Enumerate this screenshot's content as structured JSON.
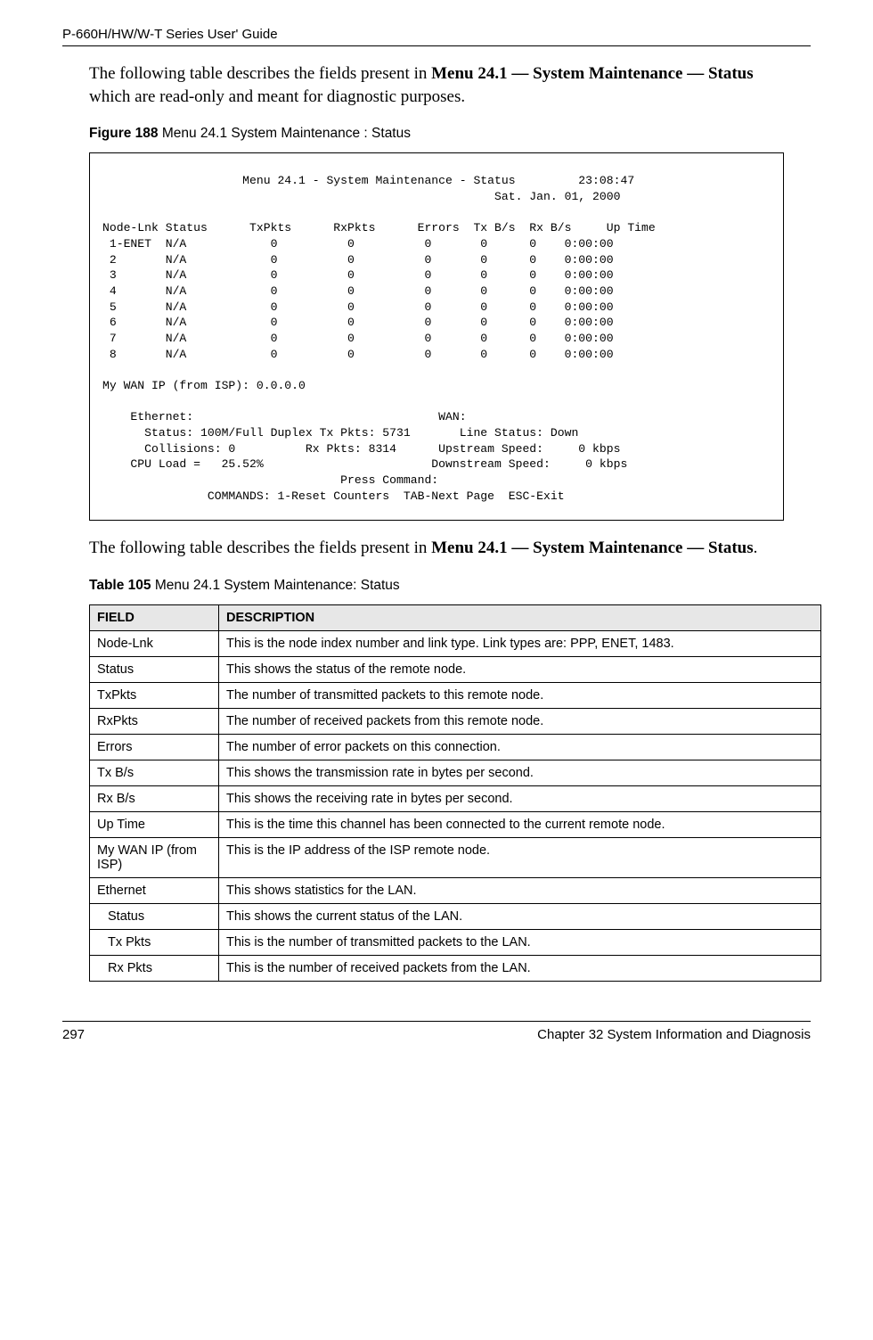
{
  "running_head": "P-660H/HW/W-T Series User' Guide",
  "para1_before": "The following table describes the fields present in ",
  "para1_bold": "Menu 24.1 — System Maintenance — Status",
  "para1_after": " which are read-only and meant for diagnostic purposes.",
  "figure_lead": "Figure 188",
  "figure_title": "   Menu 24.1 System Maintenance : Status",
  "terminal": {
    "title_line": "                    Menu 24.1 - System Maintenance - Status         23:08:47",
    "date_line": "                                                        Sat. Jan. 01, 2000",
    "header": "Node-Lnk Status      TxPkts      RxPkts      Errors  Tx B/s  Rx B/s     Up Time",
    "rows": [
      " 1-ENET  N/A            0          0          0       0      0    0:00:00",
      " 2       N/A            0          0          0       0      0    0:00:00",
      " 3       N/A            0          0          0       0      0    0:00:00",
      " 4       N/A            0          0          0       0      0    0:00:00",
      " 5       N/A            0          0          0       0      0    0:00:00",
      " 6       N/A            0          0          0       0      0    0:00:00",
      " 7       N/A            0          0          0       0      0    0:00:00",
      " 8       N/A            0          0          0       0      0    0:00:00"
    ],
    "wan_ip": "My WAN IP (from ISP): 0.0.0.0",
    "eth_hdr": "    Ethernet:                                   WAN:",
    "eth_status": "      Status: 100M/Full Duplex Tx Pkts: 5731       Line Status: Down",
    "eth_coll": "      Collisions: 0          Rx Pkts: 8314      Upstream Speed:     0 kbps",
    "cpu_line": "    CPU Load =   25.52%                        Downstream Speed:     0 kbps",
    "press_cmd": "                                  Press Command:",
    "commands": "               COMMANDS: 1-Reset Counters  TAB-Next Page  ESC-Exit"
  },
  "para2_before": "The following table describes the fields present in ",
  "para2_bold": "Menu 24.1 — System Maintenance — Status",
  "para2_after": ".",
  "table_lead": "Table 105",
  "table_title": "   Menu 24.1 System Maintenance: Status",
  "table_header": {
    "field": "FIELD",
    "desc": "DESCRIPTION"
  },
  "rows": [
    {
      "field": "Node-Lnk",
      "desc": "This is the node index number and link type. Link types are: PPP, ENET, 1483.",
      "indent": false
    },
    {
      "field": "Status",
      "desc": "This shows the status of the remote node.",
      "indent": false
    },
    {
      "field": "TxPkts",
      "desc": "The number of transmitted packets to this remote node.",
      "indent": false
    },
    {
      "field": "RxPkts",
      "desc": "The number of received packets from this remote node.",
      "indent": false
    },
    {
      "field": "Errors",
      "desc": "The number of error packets on this connection.",
      "indent": false
    },
    {
      "field": "Tx B/s",
      "desc": "This shows the transmission rate in bytes per second.",
      "indent": false
    },
    {
      "field": "Rx B/s",
      "desc": "This shows the receiving rate in bytes per second.",
      "indent": false
    },
    {
      "field": "Up Time",
      "desc": "This is the time this channel has been connected to the current remote node.",
      "indent": false
    },
    {
      "field": "My WAN IP (from ISP)",
      "desc": "This is the IP address of the ISP remote node.",
      "indent": false
    },
    {
      "field": "Ethernet",
      "desc": "This shows statistics for the LAN.",
      "indent": false
    },
    {
      "field": "Status",
      "desc": "This shows the current status of the LAN.",
      "indent": true
    },
    {
      "field": "Tx Pkts",
      "desc": "This is the number of transmitted packets to the LAN.",
      "indent": true
    },
    {
      "field": "Rx Pkts",
      "desc": "This is the number of received packets from the LAN.",
      "indent": true
    }
  ],
  "footer_left": "297",
  "footer_right": "Chapter 32 System Information and Diagnosis"
}
